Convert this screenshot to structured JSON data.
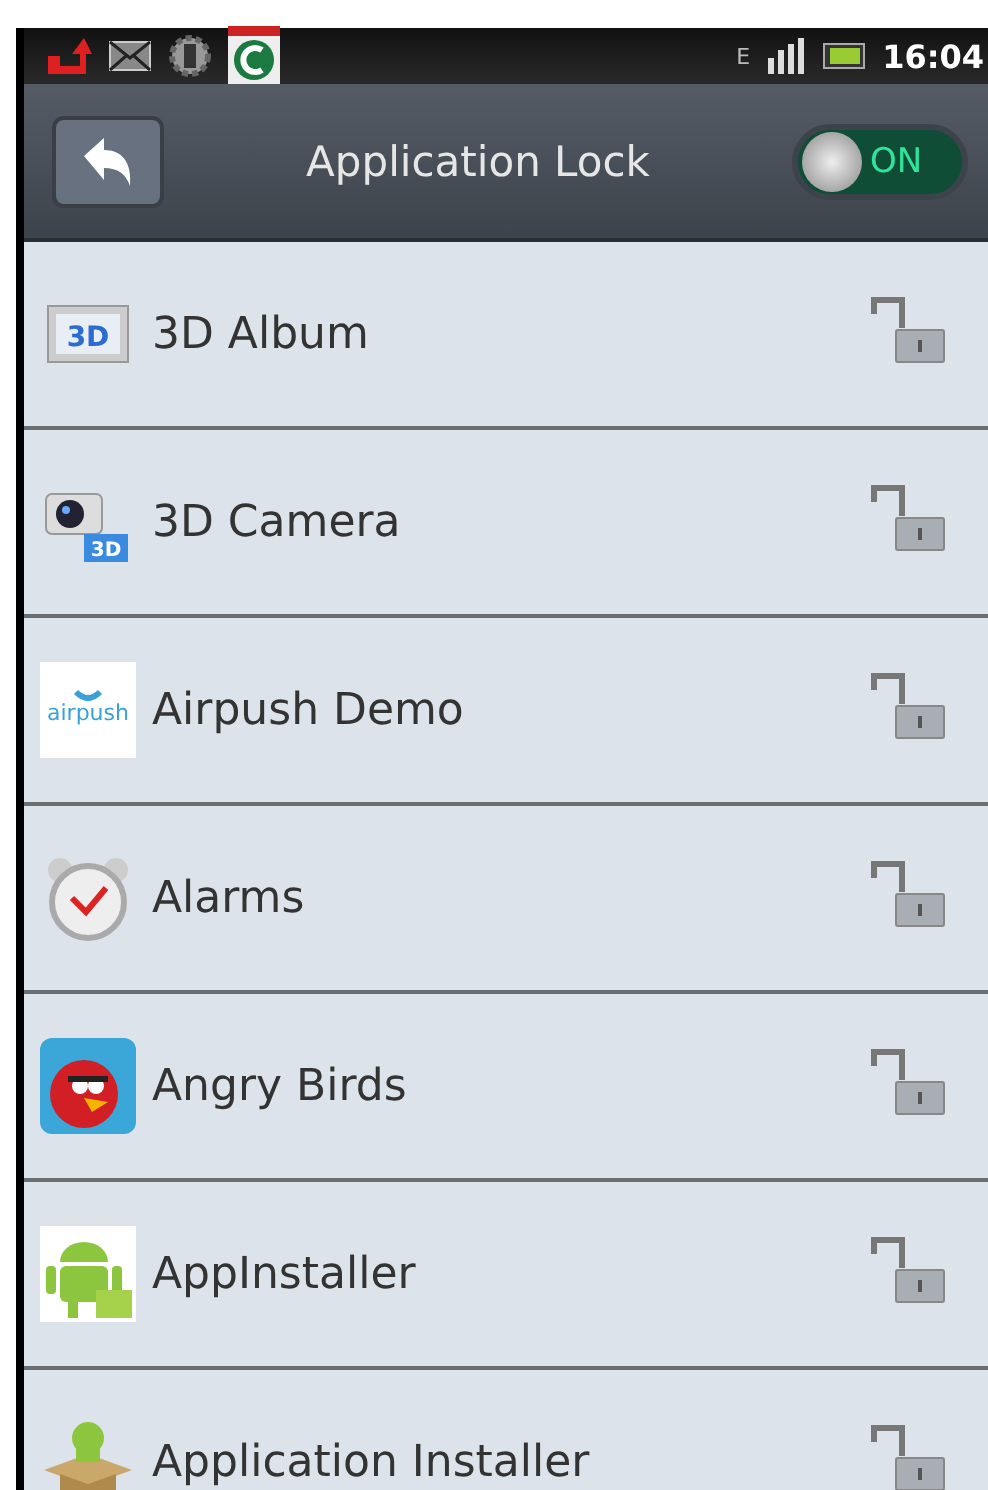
{
  "status_bar": {
    "network": "E",
    "time": "16:04"
  },
  "header": {
    "title": "Application Lock",
    "toggle": {
      "label": "ON",
      "on": true
    }
  },
  "apps": [
    {
      "name": "3D Album",
      "kind": "album",
      "icon_text": "3D",
      "locked": false
    },
    {
      "name": "3D Camera",
      "kind": "camera",
      "icon_text": "3D",
      "locked": false
    },
    {
      "name": "Airpush Demo",
      "kind": "airpush",
      "icon_text": "airpush",
      "locked": false
    },
    {
      "name": "Alarms",
      "kind": "alarm",
      "locked": false
    },
    {
      "name": "Angry Birds",
      "kind": "bird",
      "locked": false
    },
    {
      "name": "AppInstaller",
      "kind": "android",
      "locked": false
    },
    {
      "name": "Application Installer",
      "kind": "box",
      "locked": false
    }
  ]
}
